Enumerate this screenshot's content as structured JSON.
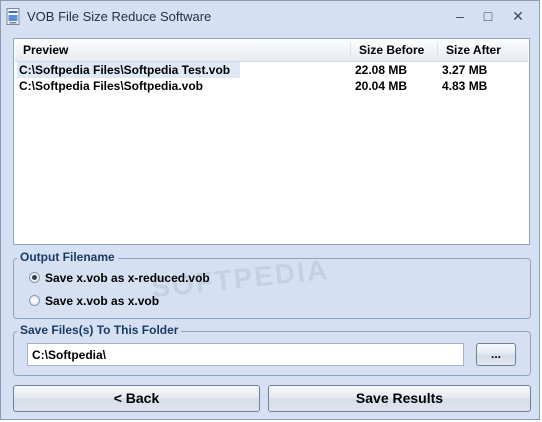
{
  "window": {
    "title": "VOB File Size Reduce Software"
  },
  "titlebar_buttons": {
    "minimize": "–",
    "maximize": "□",
    "close": "✕"
  },
  "file_list": {
    "columns": [
      "Preview",
      "Size Before",
      "Size After"
    ],
    "rows": [
      {
        "name": "C:\\Softpedia Files\\Softpedia Test.vob",
        "size_before": "22.08 MB",
        "size_after": "3.27 MB",
        "selected": true
      },
      {
        "name": "C:\\Softpedia Files\\Softpedia.vob",
        "size_before": "20.04 MB",
        "size_after": "4.83 MB",
        "selected": false
      }
    ]
  },
  "output_filename": {
    "label": "Output Filename",
    "options": [
      "Save x.vob as x-reduced.vob",
      "Save x.vob as x.vob"
    ],
    "selected_index": 0
  },
  "save_folder": {
    "label": "Save Files(s) To This Folder",
    "path": "C:\\Softpedia\\",
    "browse_label": "..."
  },
  "buttons": {
    "back": "< Back",
    "save": "Save Results"
  },
  "watermark": "SOFTPEDIA",
  "colors": {
    "window_bg": "#d5e1f2",
    "border": "#8fa5c4",
    "group_label": "#1b3a63",
    "selected_row": "#dfe9f5"
  }
}
